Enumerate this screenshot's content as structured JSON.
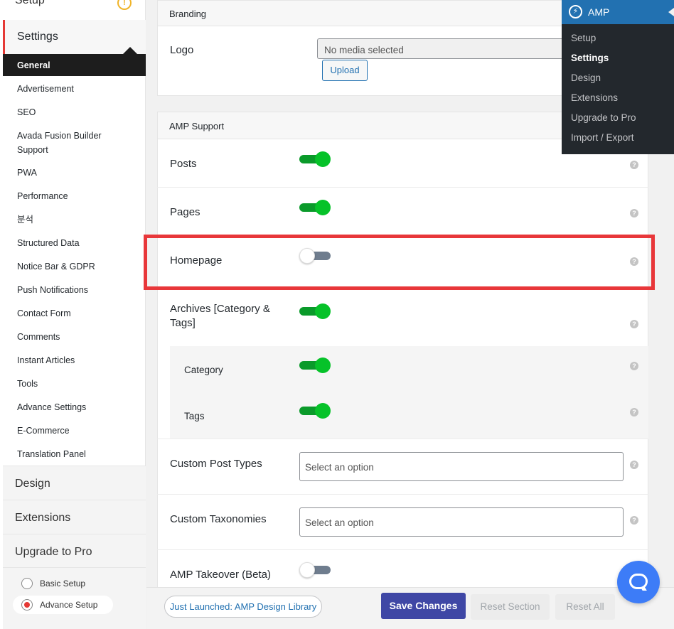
{
  "sidebar": {
    "setup_label": "Setup",
    "settings_label": "Settings",
    "general_label": "General",
    "items": [
      "Advertisement",
      "SEO",
      "Avada Fusion Builder\nSupport",
      "PWA",
      "Performance",
      "분석",
      "Structured Data",
      "Notice Bar & GDPR",
      "Push Notifications",
      "Contact Form",
      "Comments",
      "Instant Articles",
      "Tools",
      "Advance Settings",
      "E-Commerce",
      "Translation Panel"
    ],
    "design_label": "Design",
    "extensions_label": "Extensions",
    "upgrade_label": "Upgrade to Pro",
    "basic_setup_label": "Basic Setup",
    "advance_setup_label": "Advance Setup"
  },
  "branding": {
    "header": "Branding",
    "logo_label": "Logo",
    "media_placeholder": "No media selected",
    "upload_label": "Upload"
  },
  "support": {
    "header": "AMP Support",
    "posts_label": "Posts",
    "pages_label": "Pages",
    "homepage_label": "Homepage",
    "archives_label": "Archives [Category &\nTags]",
    "category_label": "Category",
    "tags_label": "Tags",
    "cpt_label": "Custom Post Types",
    "cpt_placeholder": "Select an option",
    "tax_label": "Custom Taxonomies",
    "tax_placeholder": "Select an option",
    "takeover_label": "AMP Takeover (Beta)",
    "help_glyph": "?"
  },
  "toggles": {
    "posts": true,
    "pages": true,
    "homepage": false,
    "archives": true,
    "category": true,
    "tags": true,
    "takeover": false
  },
  "amp_menu": {
    "title": "AMP",
    "items": [
      "Setup",
      "Settings",
      "Design",
      "Extensions",
      "Upgrade to Pro",
      "Import / Export"
    ],
    "active": "Settings"
  },
  "footer": {
    "design_library_label": "Just Launched: AMP Design Library",
    "save_label": "Save Changes",
    "reset_section_label": "Reset Section",
    "reset_all_label": "Reset All"
  },
  "colors": {
    "toggle_on": "#06c229",
    "save_button": "#3f47a5",
    "highlight": "#e8373a",
    "amp_blue": "#2271b1"
  }
}
